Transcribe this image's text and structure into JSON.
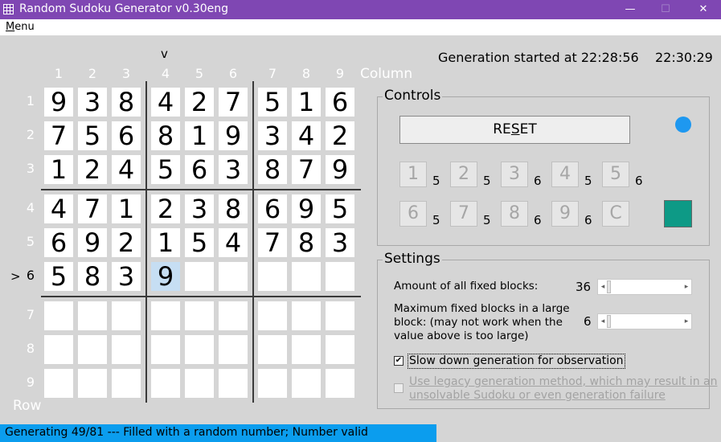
{
  "window": {
    "title": "Random Sudoku Generator v0.30eng",
    "minimize_glyph": "—",
    "maximize_glyph": "☐",
    "close_glyph": "✕"
  },
  "menu": {
    "label_first": "M",
    "label_rest": "enu"
  },
  "grid": {
    "column_labels": [
      "1",
      "2",
      "3",
      "4",
      "5",
      "6",
      "7",
      "8",
      "9"
    ],
    "row_labels": [
      "1",
      "2",
      "3",
      "4",
      "5",
      "6",
      "7",
      "8",
      "9"
    ],
    "column_word": "Column",
    "row_word": "Row",
    "column_marker": "v",
    "row_marker": ">",
    "current_column": 4,
    "current_row": 6,
    "cells": [
      [
        "9",
        "3",
        "8",
        "4",
        "2",
        "7",
        "5",
        "1",
        "6"
      ],
      [
        "7",
        "5",
        "6",
        "8",
        "1",
        "9",
        "3",
        "4",
        "2"
      ],
      [
        "1",
        "2",
        "4",
        "5",
        "6",
        "3",
        "8",
        "7",
        "9"
      ],
      [
        "4",
        "7",
        "1",
        "2",
        "3",
        "8",
        "6",
        "9",
        "5"
      ],
      [
        "6",
        "9",
        "2",
        "1",
        "5",
        "4",
        "7",
        "8",
        "3"
      ],
      [
        "5",
        "8",
        "3",
        "9",
        "",
        "",
        "",
        "",
        ""
      ],
      [
        "",
        "",
        "",
        "",
        "",
        "",
        "",
        "",
        ""
      ],
      [
        "",
        "",
        "",
        "",
        "",
        "",
        "",
        "",
        ""
      ],
      [
        "",
        "",
        "",
        "",
        "",
        "",
        "",
        "",
        ""
      ]
    ]
  },
  "header": {
    "generation_started": "Generation started at 22:28:56",
    "current_time": "22:30:29"
  },
  "controls": {
    "title": "Controls",
    "reset_first": "RE",
    "reset_underlined": "S",
    "reset_rest": "ET",
    "status_color": "#1e98f0",
    "swatch_color": "#0d9a86",
    "number_buttons": [
      {
        "label": "1",
        "count": "5"
      },
      {
        "label": "2",
        "count": "5"
      },
      {
        "label": "3",
        "count": "6"
      },
      {
        "label": "4",
        "count": "5"
      },
      {
        "label": "5",
        "count": "6"
      },
      {
        "label": "6",
        "count": "5"
      },
      {
        "label": "7",
        "count": "5"
      },
      {
        "label": "8",
        "count": "6"
      },
      {
        "label": "9",
        "count": "6"
      }
    ],
    "clear_label": "C"
  },
  "settings": {
    "title": "Settings",
    "fixed_blocks_label": "Amount of all fixed blocks:",
    "fixed_blocks_value": "36",
    "max_block_label_line1": "Maximum fixed blocks in a large",
    "max_block_label_line2": "block: (may not work when the",
    "max_block_label_line3": "value above is too large)",
    "max_block_value": "6",
    "slow_down_label": "Slow down generation for observation",
    "slow_down_checked": true,
    "legacy_label_line1": "Use legacy generation method, which may result in an",
    "legacy_label_line2": "unsolvable Sudoku or even generation failure",
    "legacy_checked": false
  },
  "status": {
    "text": "Generating 49/81 --- Filled with a random number; Number valid",
    "progress": 0.605
  }
}
